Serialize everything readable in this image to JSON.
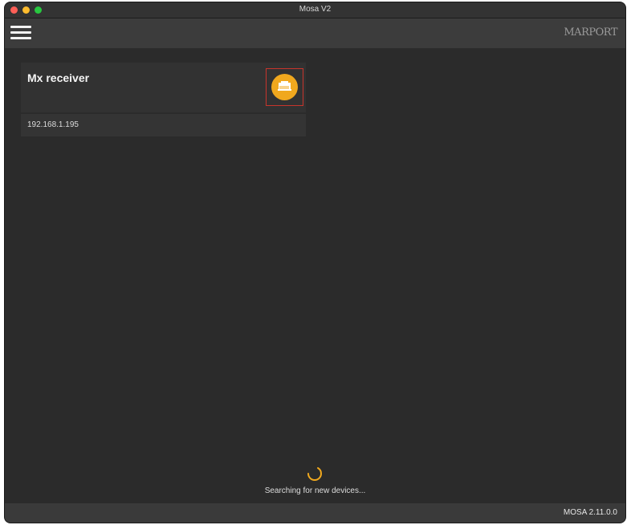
{
  "window": {
    "title": "Mosa V2"
  },
  "toolbar": {
    "menu_icon": "hamburger-menu-icon",
    "logo_text": "MARPORT"
  },
  "devices": [
    {
      "name": "Mx receiver",
      "ip": "192.168.1.195",
      "icon": "ethernet-port-icon",
      "icon_color": "#f0a81e",
      "highlight_color": "#c8342c"
    }
  ],
  "status": {
    "searching_text": "Searching for new devices...",
    "spinner_color": "#f0a81e"
  },
  "footer": {
    "version": "MOSA 2.11.0.0"
  }
}
